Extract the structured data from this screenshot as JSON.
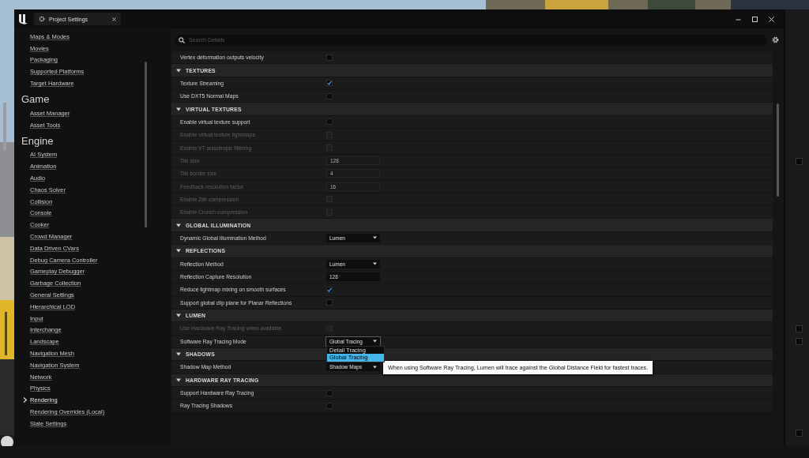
{
  "window": {
    "tab_title": "Project Settings"
  },
  "sidebar": {
    "sections": [
      {
        "items": [
          {
            "label": "Maps & Modes",
            "selected": false
          },
          {
            "label": "Movies",
            "selected": false
          },
          {
            "label": "Packaging",
            "selected": false
          },
          {
            "label": "Supported Platforms",
            "selected": false
          },
          {
            "label": "Target Hardware",
            "selected": false
          }
        ]
      },
      {
        "title": "Game",
        "items": [
          {
            "label": "Asset Manager",
            "selected": false
          },
          {
            "label": "Asset Tools",
            "selected": false
          }
        ]
      },
      {
        "title": "Engine",
        "items": [
          {
            "label": "AI System",
            "selected": false
          },
          {
            "label": "Animation",
            "selected": false
          },
          {
            "label": "Audio",
            "selected": false
          },
          {
            "label": "Chaos Solver",
            "selected": false
          },
          {
            "label": "Collision",
            "selected": false
          },
          {
            "label": "Console",
            "selected": false
          },
          {
            "label": "Cooker",
            "selected": false
          },
          {
            "label": "Crowd Manager",
            "selected": false
          },
          {
            "label": "Data Driven CVars",
            "selected": false
          },
          {
            "label": "Debug Camera Controller",
            "selected": false
          },
          {
            "label": "Gameplay Debugger",
            "selected": false
          },
          {
            "label": "Garbage Collection",
            "selected": false
          },
          {
            "label": "General Settings",
            "selected": false
          },
          {
            "label": "Hierarchical LOD",
            "selected": false
          },
          {
            "label": "Input",
            "selected": false
          },
          {
            "label": "Interchange",
            "selected": false
          },
          {
            "label": "Landscape",
            "selected": false
          },
          {
            "label": "Navigation Mesh",
            "selected": false
          },
          {
            "label": "Navigation System",
            "selected": false
          },
          {
            "label": "Network",
            "selected": false
          },
          {
            "label": "Physics",
            "selected": false
          },
          {
            "label": "Rendering",
            "selected": true
          },
          {
            "label": "Rendering Overrides (Local)",
            "selected": false
          },
          {
            "label": "Slate Settings",
            "selected": false
          }
        ]
      }
    ]
  },
  "search": {
    "placeholder": "Search Details"
  },
  "settings": [
    {
      "kind": "checkbox",
      "label": "Vertex deformation outputs velocity",
      "checked": false,
      "disabled": false
    },
    {
      "kind": "header",
      "label": "TEXTURES",
      "expanded": true
    },
    {
      "kind": "checkbox",
      "label": "Texture Streaming",
      "checked": true,
      "disabled": false
    },
    {
      "kind": "checkbox",
      "label": "Use DXT5 Normal Maps",
      "checked": false,
      "disabled": false
    },
    {
      "kind": "header",
      "label": "VIRTUAL TEXTURES",
      "expanded": true
    },
    {
      "kind": "checkbox",
      "label": "Enable virtual texture support",
      "checked": false,
      "disabled": false
    },
    {
      "kind": "checkbox",
      "label": "Enable virtual texture lightmaps",
      "checked": false,
      "disabled": true
    },
    {
      "kind": "checkbox",
      "label": "Enable VT anisotropic filtering",
      "checked": false,
      "disabled": true
    },
    {
      "kind": "number",
      "label": "Tile size",
      "value": "128",
      "disabled": true
    },
    {
      "kind": "number",
      "label": "Tile border size",
      "value": "4",
      "disabled": true
    },
    {
      "kind": "number",
      "label": "Feedback resolution factor",
      "value": "16",
      "disabled": true
    },
    {
      "kind": "checkbox",
      "label": "Enable Zlib compression",
      "checked": false,
      "disabled": true
    },
    {
      "kind": "checkbox",
      "label": "Enable Crunch compression",
      "checked": false,
      "disabled": true
    },
    {
      "kind": "header",
      "label": "GLOBAL ILLUMINATION",
      "expanded": true
    },
    {
      "kind": "dropdown",
      "label": "Dynamic Global Illumination Method",
      "value": "Lumen",
      "open": false
    },
    {
      "kind": "header",
      "label": "REFLECTIONS",
      "expanded": true
    },
    {
      "kind": "dropdown",
      "label": "Reflection Method",
      "value": "Lumen",
      "open": false
    },
    {
      "kind": "number",
      "label": "Reflection Capture Resolution",
      "value": "128",
      "disabled": false
    },
    {
      "kind": "checkbox",
      "label": "Reduce lightmap mixing on smooth surfaces",
      "checked": true,
      "disabled": false
    },
    {
      "kind": "checkbox",
      "label": "Support global clip plane for Planar Reflections",
      "checked": false,
      "disabled": false
    },
    {
      "kind": "header",
      "label": "LUMEN",
      "expanded": true
    },
    {
      "kind": "checkbox",
      "label": "Use Hardware Ray Tracing when available",
      "checked": false,
      "disabled": true
    },
    {
      "kind": "dropdown",
      "label": "Software Ray Tracing Mode",
      "value": "Global Tracing",
      "open": true,
      "options": [
        {
          "label": "Detail Tracing",
          "selected": false
        },
        {
          "label": "Global Tracing",
          "selected": true
        }
      ],
      "tooltip": "When using Software Ray Tracing, Lumen will trace against the Global Distance Field for fastest traces."
    },
    {
      "kind": "header",
      "label": "SHADOWS",
      "expanded": true
    },
    {
      "kind": "dropdown",
      "label": "Shadow Map Method",
      "value": "Shadow Maps",
      "open": false
    },
    {
      "kind": "header",
      "label": "HARDWARE RAY TRACING",
      "expanded": true
    },
    {
      "kind": "checkbox",
      "label": "Support Hardware Ray Tracing",
      "checked": false,
      "disabled": false
    },
    {
      "kind": "checkbox",
      "label": "Ray Tracing Shadows",
      "checked": false,
      "disabled": false
    }
  ]
}
